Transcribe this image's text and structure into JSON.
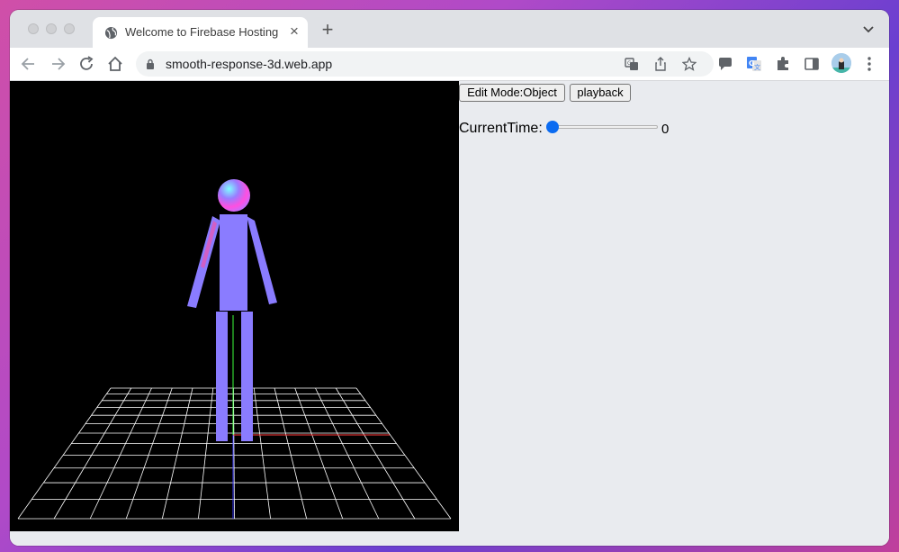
{
  "browser": {
    "tab_title": "Welcome to Firebase Hosting",
    "tab_close": "×",
    "new_tab": "+",
    "url": "smooth-response-3d.web.app"
  },
  "icons": {
    "back": "arrow-left-icon",
    "forward": "arrow-right-icon",
    "reload": "reload-icon",
    "home": "home-icon",
    "translate": "translate-icon",
    "share": "share-icon",
    "bookmark": "star-icon",
    "extension_chat": "chat-extension-icon",
    "extension_google_translate": "google-translate-icon",
    "extensions": "puzzle-icon",
    "side_panel": "side-panel-icon",
    "menu": "kebab-menu-icon"
  },
  "app": {
    "edit_mode_button": "Edit Mode:Object",
    "playback_button": "playback",
    "current_time_label": "CurrentTime:",
    "current_time_value": "0",
    "slider_fraction": 0
  },
  "colors": {
    "accent": "#0b6bf1",
    "character": "#8a7cff",
    "grid": "#ffffff",
    "axis_x": "#ff3b3b",
    "axis_y": "#3bff3b",
    "axis_z": "#3b3bff"
  }
}
